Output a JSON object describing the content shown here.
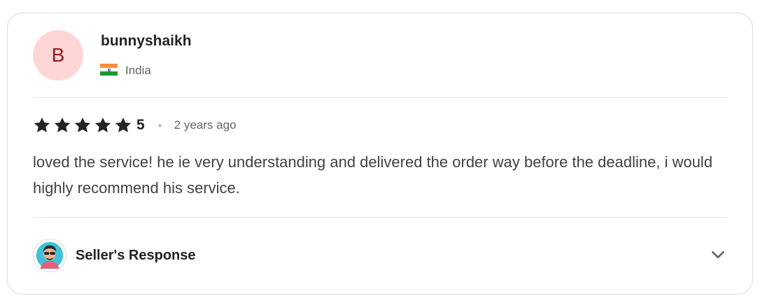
{
  "reviewer": {
    "avatar_initial": "B",
    "avatar_bg": "#ffd6d6",
    "avatar_color": "#8f1d22",
    "username": "bunnyshaikh",
    "country": "India",
    "flag_icon": "india-flag-icon"
  },
  "rating": {
    "stars": 5,
    "score": "5",
    "time_ago": "2 years ago"
  },
  "review": {
    "text": "loved the service! he ie very understanding and delivered the order way before the deadline, i would highly recommend his service."
  },
  "seller_response": {
    "label": "Seller's Response",
    "avatar_icon": "seller-avatar-icon",
    "toggle_icon": "chevron-down-icon"
  }
}
